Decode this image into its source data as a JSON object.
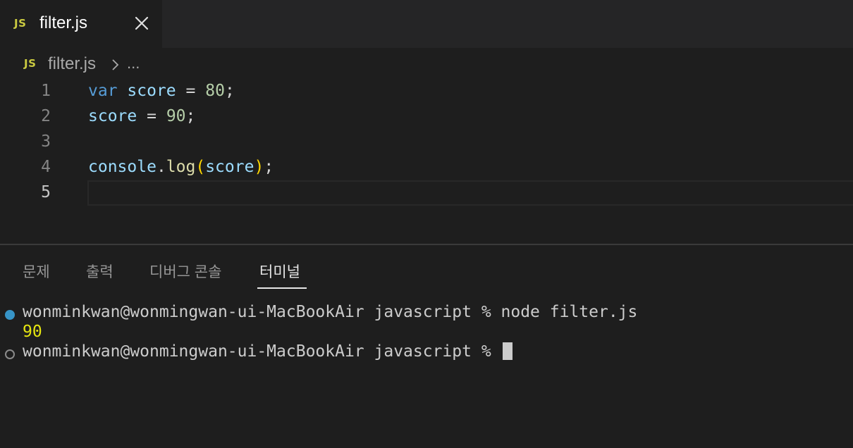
{
  "tab": {
    "icon_text": "JS",
    "label": "filter.js",
    "close_icon": "close-icon"
  },
  "breadcrumb": {
    "icon_text": "JS",
    "file": "filter.js",
    "separator_icon": "chevron-right-icon",
    "more": "..."
  },
  "editor": {
    "lines": [
      {
        "number": "1"
      },
      {
        "number": "2"
      },
      {
        "number": "3"
      },
      {
        "number": "4"
      },
      {
        "number": "5"
      }
    ],
    "tokens": {
      "l1_kw": "var",
      "l1_var": "score",
      "l1_op": "=",
      "l1_num": "80",
      "l1_end": ";",
      "l2_var": "score",
      "l2_op": "=",
      "l2_num": "90",
      "l2_end": ";",
      "l4_obj": "console",
      "l4_dot": ".",
      "l4_fn": "log",
      "l4_open": "(",
      "l4_arg": "score",
      "l4_close": ")",
      "l4_end": ";"
    },
    "active_line": "5"
  },
  "panel": {
    "tabs": [
      "문제",
      "출력",
      "디버그 콘솔",
      "터미널"
    ],
    "active_tab": "터미널"
  },
  "terminal": {
    "prompt": "wonminkwan@wonmingwan-ui-MacBookAir javascript % ",
    "command": "node filter.js",
    "output": "90",
    "prompt2": "wonminkwan@wonmingwan-ui-MacBookAir javascript % "
  },
  "colors": {
    "js_icon": "#cbcb41",
    "keyword": "#569cd6",
    "variable": "#9cdcfe",
    "number": "#b5cea8",
    "function": "#dcdcaa",
    "bracket": "#ffd700",
    "terminal_output": "#e5e510",
    "success_dot": "#3794c7"
  }
}
